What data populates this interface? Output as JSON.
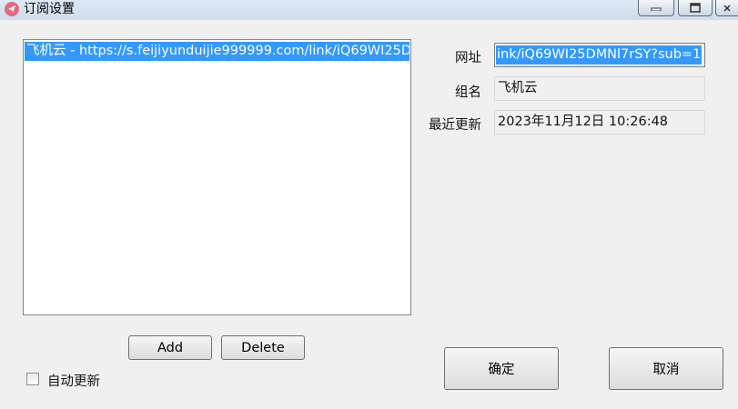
{
  "window": {
    "title": "订阅设置",
    "colors": {
      "titlebar": "#d6e2ef",
      "selection": "#3399ff",
      "icon": "#e46a83"
    }
  },
  "subscriptions": [
    {
      "label": "飞机云 - https://s.feijiyunduijie999999.com/link/iQ69WI25D",
      "selected": true
    }
  ],
  "buttons": {
    "add": "Add",
    "delete": "Delete",
    "ok": "确定",
    "cancel": "取消"
  },
  "auto_update": {
    "label": "自动更新",
    "checked": false
  },
  "form": {
    "url_label": "网址",
    "url_value": "ink/iQ69WI25DMNl7rSY?sub=1",
    "group_label": "组名",
    "group_value": "飞机云",
    "updated_label": "最近更新",
    "updated_value": "2023年11月12日 10:26:48"
  },
  "icons": [
    "app-icon",
    "minimize-icon",
    "maximize-icon",
    "close-icon",
    "checkbox-icon"
  ]
}
